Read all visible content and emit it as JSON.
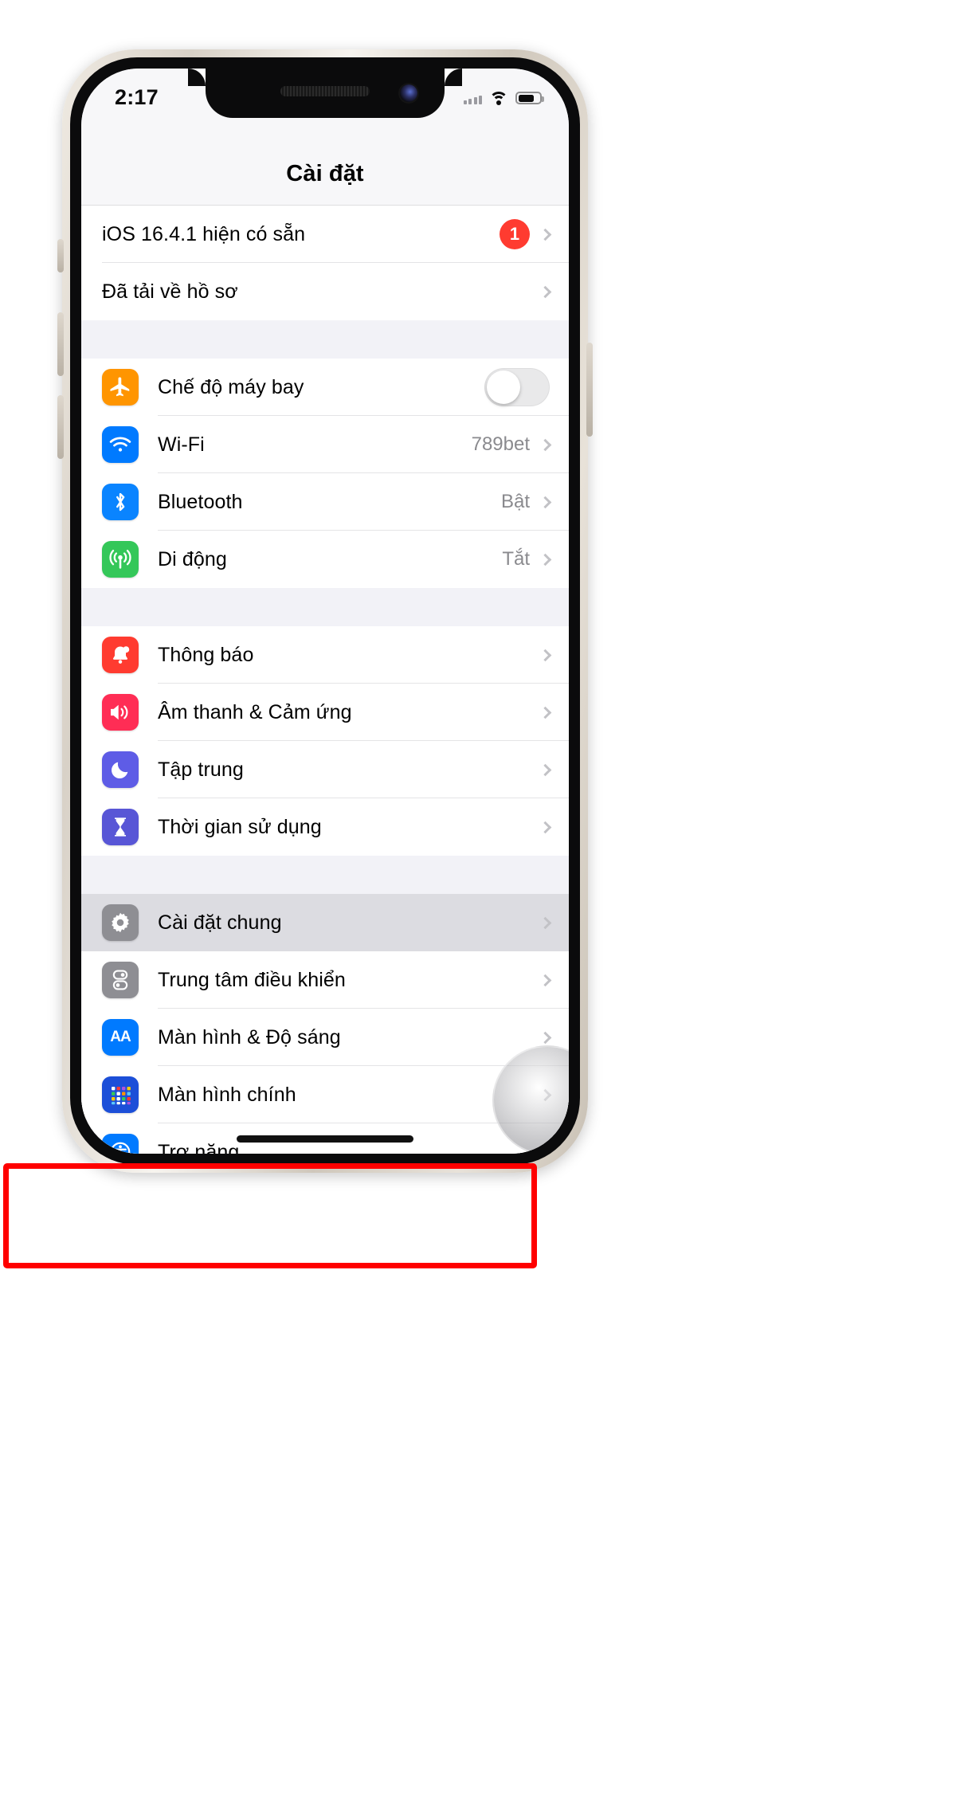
{
  "status_bar": {
    "time": "2:17",
    "signal_icon": "cellular-signal-icon",
    "wifi_icon": "wifi-icon",
    "battery_icon": "battery-icon"
  },
  "nav": {
    "title": "Cài đặt"
  },
  "groups": [
    {
      "id": "software-update",
      "rows": [
        {
          "label": "iOS 16.4.1 hiện có sẵn",
          "badge": "1",
          "chevron": true,
          "icon": null
        },
        {
          "label": "Đã tải về hồ sơ",
          "chevron": true,
          "icon": null
        }
      ]
    },
    {
      "id": "connectivity",
      "rows": [
        {
          "label": "Chế độ máy bay",
          "icon": "airplane-icon",
          "icon_color": "#ff9500",
          "toggle": "off"
        },
        {
          "label": "Wi-Fi",
          "icon": "wifi-icon",
          "icon_color": "#007aff",
          "value": "789bet",
          "chevron": true
        },
        {
          "label": "Bluetooth",
          "icon": "bluetooth-icon",
          "icon_color": "#0a84ff",
          "value": "Bật",
          "chevron": true
        },
        {
          "label": "Di động",
          "icon": "cellular-icon",
          "icon_color": "#34c759",
          "value": "Tắt",
          "chevron": true
        }
      ]
    },
    {
      "id": "alerts",
      "rows": [
        {
          "label": "Thông báo",
          "icon": "bell-icon",
          "icon_color": "#ff3b30",
          "chevron": true
        },
        {
          "label": "Âm thanh & Cảm ứng",
          "icon": "speaker-icon",
          "icon_color": "#ff2d55",
          "chevron": true
        },
        {
          "label": "Tập trung",
          "icon": "moon-icon",
          "icon_color": "#5e5ce6",
          "chevron": true
        },
        {
          "label": "Thời gian sử dụng",
          "icon": "hourglass-icon",
          "icon_color": "#5856d6",
          "chevron": true
        }
      ]
    },
    {
      "id": "system",
      "rows": [
        {
          "label": "Cài đặt chung",
          "icon": "gear-icon",
          "icon_color": "#8e8e93",
          "chevron": true,
          "highlighted": true
        },
        {
          "label": "Trung tâm điều khiển",
          "icon": "control-center-icon",
          "icon_color": "#8e8e93",
          "chevron": true
        },
        {
          "label": "Màn hình & Độ sáng",
          "icon": "display-aa-icon",
          "icon_color": "#007aff",
          "chevron": true
        },
        {
          "label": "Màn hình chính",
          "icon": "home-screen-icon",
          "icon_color": "#1c4fd8",
          "chevron": true
        },
        {
          "label": "Trợ năng",
          "icon": "accessibility-icon",
          "icon_color": "#007aff",
          "chevron": true
        }
      ]
    }
  ],
  "annotation": {
    "highlight_color": "#ff0000",
    "highlight_target": "Cài đặt chung"
  }
}
